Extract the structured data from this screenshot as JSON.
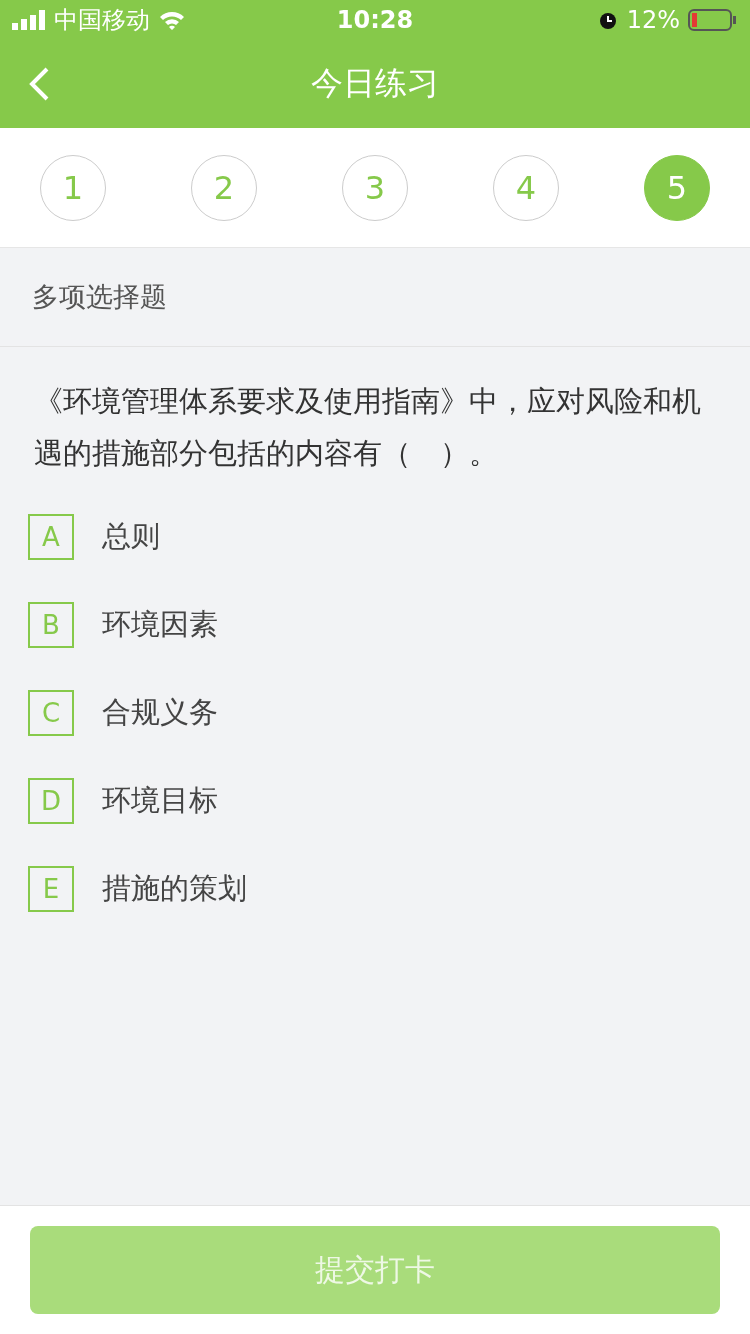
{
  "status_bar": {
    "carrier": "中国移动",
    "time": "10:28",
    "battery": "12%"
  },
  "nav": {
    "title": "今日练习"
  },
  "questions": [
    {
      "label": "1",
      "selected": false
    },
    {
      "label": "2",
      "selected": false
    },
    {
      "label": "3",
      "selected": false
    },
    {
      "label": "4",
      "selected": false
    },
    {
      "label": "5",
      "selected": true
    }
  ],
  "question_type": "多项选择题",
  "question_text": "《环境管理体系要求及使用指南》中，应对风险和机遇的措施部分包括的内容有（　）。",
  "options": [
    {
      "letter": "A",
      "text": "总则",
      "checked": false
    },
    {
      "letter": "B",
      "text": "环境因素",
      "checked": false
    },
    {
      "letter": "C",
      "text": "合规义务",
      "checked": false
    },
    {
      "letter": "D",
      "text": "环境目标",
      "checked": false
    },
    {
      "letter": "E",
      "text": "措施的策划",
      "checked": false
    }
  ],
  "submit": {
    "label": "提交打卡",
    "disabled": true
  }
}
